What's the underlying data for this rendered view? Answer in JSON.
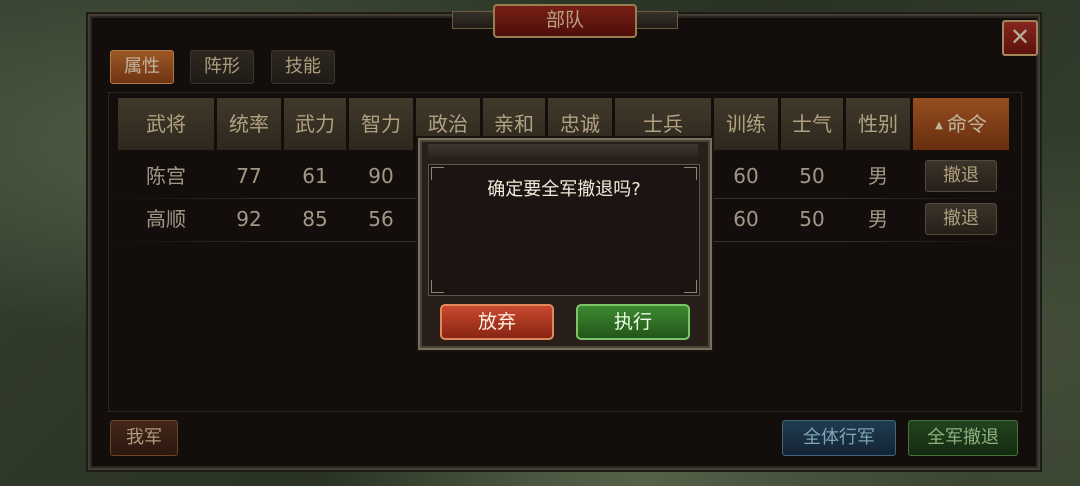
{
  "panel": {
    "title": "部队",
    "close_label": "✕"
  },
  "tabs": [
    {
      "label": "属性",
      "active": true
    },
    {
      "label": "阵形",
      "active": false
    },
    {
      "label": "技能",
      "active": false
    }
  ],
  "table": {
    "headers": [
      "武将",
      "统率",
      "武力",
      "智力",
      "政治",
      "亲和",
      "忠诚",
      "士兵",
      "训练",
      "士气",
      "性别",
      "命令"
    ],
    "sorted_column": "命令",
    "rows": [
      {
        "name": "陈宫",
        "tong": "77",
        "wu": "61",
        "zhi": "90",
        "train": "60",
        "morale": "50",
        "gender": "男",
        "action": "撤退"
      },
      {
        "name": "高顺",
        "tong": "92",
        "wu": "85",
        "zhi": "56",
        "train": "60",
        "morale": "50",
        "gender": "男",
        "action": "撤退"
      }
    ]
  },
  "bottom": {
    "my_army": "我军",
    "all_march": "全体行军",
    "all_retreat": "全军撤退"
  },
  "dialog": {
    "message": "确定要全军撤退吗?",
    "cancel_label": "放弃",
    "confirm_label": "执行"
  },
  "colors": {
    "panel_bg": "#1a1210",
    "header_bg": "#574d39",
    "active_tab": "#d2752f",
    "cancel_red": "#c8492e",
    "confirm_green": "#3c8a30",
    "march_blue": "#2c4f6a"
  }
}
